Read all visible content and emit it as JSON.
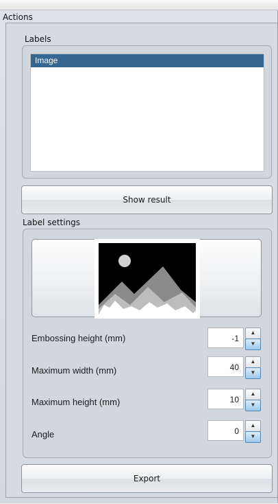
{
  "actions_title": "Actions",
  "labels_group": {
    "title": "Labels",
    "items": [
      "Image"
    ]
  },
  "show_result_label": "Show result",
  "label_settings": {
    "title": "Label settings",
    "preview_icon": "mountain-image-icon",
    "rows": [
      {
        "label": "Embossing height (mm)",
        "value": "-1"
      },
      {
        "label": "Maximum width (mm)",
        "value": "40"
      },
      {
        "label": "Maximum height (mm)",
        "value": "10"
      },
      {
        "label": "Angle",
        "value": "0"
      }
    ]
  },
  "export_label": "Export",
  "spin_icons": {
    "up": "▲",
    "down": "▼"
  },
  "colors": {
    "selection": "#356691"
  }
}
